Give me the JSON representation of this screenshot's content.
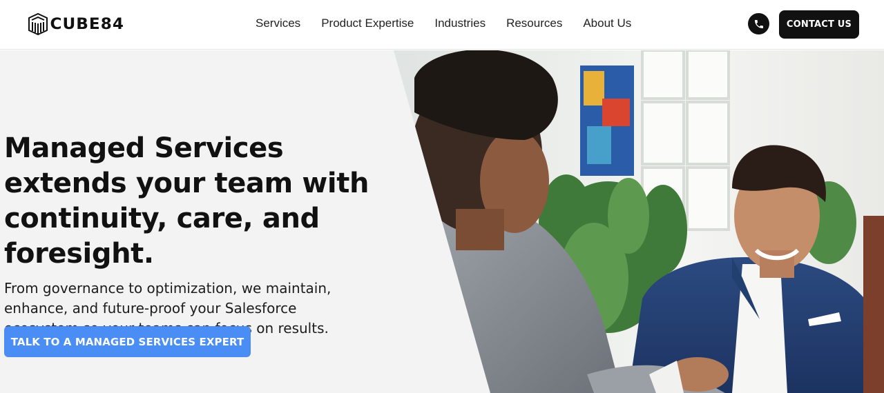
{
  "header": {
    "logo_text": "CUBE84",
    "nav": [
      {
        "label": "Services"
      },
      {
        "label": "Product Expertise"
      },
      {
        "label": "Industries"
      },
      {
        "label": "Resources"
      },
      {
        "label": "About Us"
      }
    ],
    "phone_icon": "phone-icon",
    "contact_label": "CONTACT US"
  },
  "hero": {
    "headline": "Managed Services extends your team with continuity, care, and foresight.",
    "subtext": "From governance to optimization, we maintain, enhance, and future-proof your Salesforce ecosystem so your teams can focus on results.",
    "cta_label": "TALK TO A MANAGED SERVICES EXPERT",
    "cta_color": "#4a8ef5",
    "photo": "handshake-office-photo"
  },
  "colors": {
    "dark": "#111111",
    "hero_bg": "#f3f3f3"
  }
}
